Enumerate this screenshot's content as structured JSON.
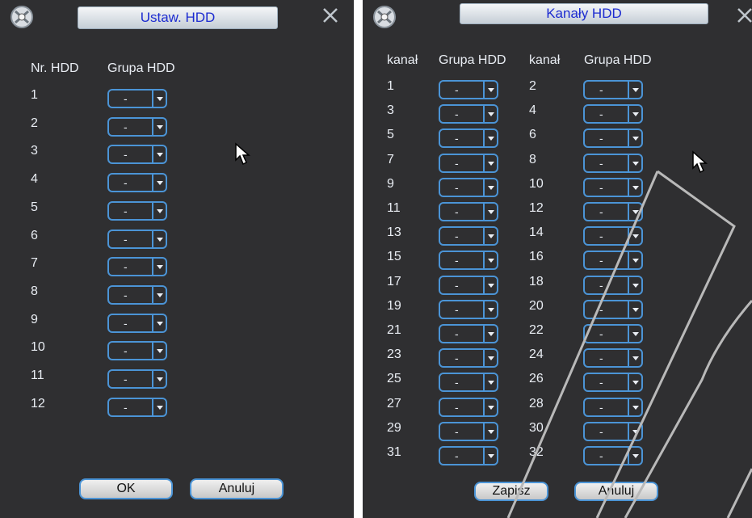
{
  "left": {
    "title": "Ustaw. HDD",
    "header_nr": "Nr. HDD",
    "header_group": "Grupa HDD",
    "rows": [
      {
        "n": "1",
        "v": "-"
      },
      {
        "n": "2",
        "v": "-"
      },
      {
        "n": "3",
        "v": "-"
      },
      {
        "n": "4",
        "v": "-"
      },
      {
        "n": "5",
        "v": "-"
      },
      {
        "n": "6",
        "v": "-"
      },
      {
        "n": "7",
        "v": "-"
      },
      {
        "n": "8",
        "v": "-"
      },
      {
        "n": "9",
        "v": "-"
      },
      {
        "n": "10",
        "v": "-"
      },
      {
        "n": "11",
        "v": "-"
      },
      {
        "n": "12",
        "v": "-"
      }
    ],
    "ok_label": "OK",
    "cancel_label": "Anuluj"
  },
  "right": {
    "title": "Kanały HDD",
    "header_channel": "kanał",
    "header_group": "Grupa HDD",
    "rows": [
      {
        "a": "1",
        "av": "-",
        "b": "2",
        "bv": "-"
      },
      {
        "a": "3",
        "av": "-",
        "b": "4",
        "bv": "-"
      },
      {
        "a": "5",
        "av": "-",
        "b": "6",
        "bv": "-"
      },
      {
        "a": "7",
        "av": "-",
        "b": "8",
        "bv": "-"
      },
      {
        "a": "9",
        "av": "-",
        "b": "10",
        "bv": "-"
      },
      {
        "a": "11",
        "av": "-",
        "b": "12",
        "bv": "-"
      },
      {
        "a": "13",
        "av": "-",
        "b": "14",
        "bv": "-"
      },
      {
        "a": "15",
        "av": "-",
        "b": "16",
        "bv": "-"
      },
      {
        "a": "17",
        "av": "-",
        "b": "18",
        "bv": "-"
      },
      {
        "a": "19",
        "av": "-",
        "b": "20",
        "bv": "-"
      },
      {
        "a": "21",
        "av": "-",
        "b": "22",
        "bv": "-"
      },
      {
        "a": "23",
        "av": "-",
        "b": "24",
        "bv": "-"
      },
      {
        "a": "25",
        "av": "-",
        "b": "26",
        "bv": "-"
      },
      {
        "a": "27",
        "av": "-",
        "b": "28",
        "bv": "-"
      },
      {
        "a": "29",
        "av": "-",
        "b": "30",
        "bv": "-"
      },
      {
        "a": "31",
        "av": "-",
        "b": "32",
        "bv": "-"
      }
    ],
    "save_label": "Zapisz",
    "cancel_label": "Anuluj"
  },
  "icons": [
    "app-logo-icon",
    "close-icon",
    "mouse-cursor-icon"
  ],
  "colors": {
    "panel_bg": "#2f2f31",
    "accent": "#4b94d6",
    "title_text": "#1c2bd0",
    "text": "#e9edf3"
  }
}
